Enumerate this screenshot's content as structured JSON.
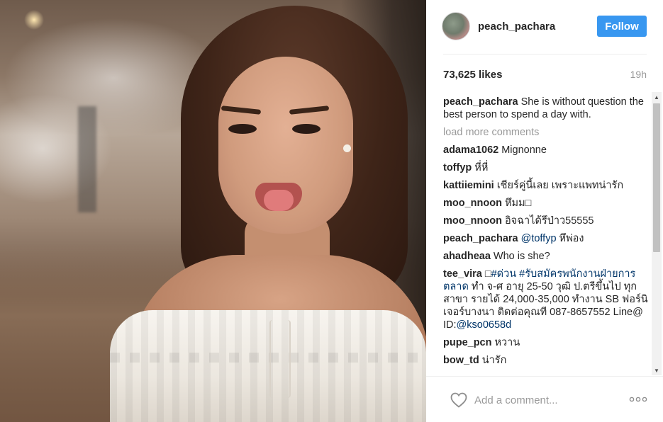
{
  "post": {
    "username": "peach_pachara",
    "follow_label": "Follow",
    "likes": "73,625 likes",
    "timestamp": "19h",
    "load_more": "load more comments",
    "add_comment_placeholder": "Add a comment..."
  },
  "comments": [
    {
      "author": "peach_pachara",
      "text": "She is without question the best person to spend a day with."
    },
    {
      "author": "adama1062",
      "text": "Mignonne"
    },
    {
      "author": "toffyp",
      "text": "หี่หี่"
    },
    {
      "author": "kattiiemini",
      "text": "เชียร์คู่นี้เลย เพราะแพทน่ารัก"
    },
    {
      "author": "moo_nnoon",
      "text": "หึมม□"
    },
    {
      "author": "moo_nnoon",
      "text": "อิจฉาได้รึป่าว55555"
    },
    {
      "author": "peach_pachara",
      "tag": "@toffyp",
      "text": "หึพ่อง"
    },
    {
      "author": "ahadheaa",
      "text": "Who is she?"
    },
    {
      "author": "tee_vira",
      "prefix": "□",
      "tag": "#ด่วน #รับสมัครพนักงานฝ่ายการตลาด",
      "text": "ทำ จ-ศ อายุ 25-50 วุฒิ ป.ตรีขึ้นไป ทุกสาขา รายได้ 24,000-35,000 ทำงาน SB ฟอร์นิเจอร์บางนา ติดต่อคุณที 087-8657552 Line@ ID:",
      "tag2": "@kso0658d"
    },
    {
      "author": "pupe_pcn",
      "text": "หวาน"
    },
    {
      "author": "bow_td",
      "text": "น่ารัก"
    }
  ],
  "colors": {
    "follow_button": "#3897f0",
    "tag": "#003569",
    "muted": "#999999"
  },
  "icons": {
    "heart": "heart-icon",
    "more": "more-options-icon"
  }
}
